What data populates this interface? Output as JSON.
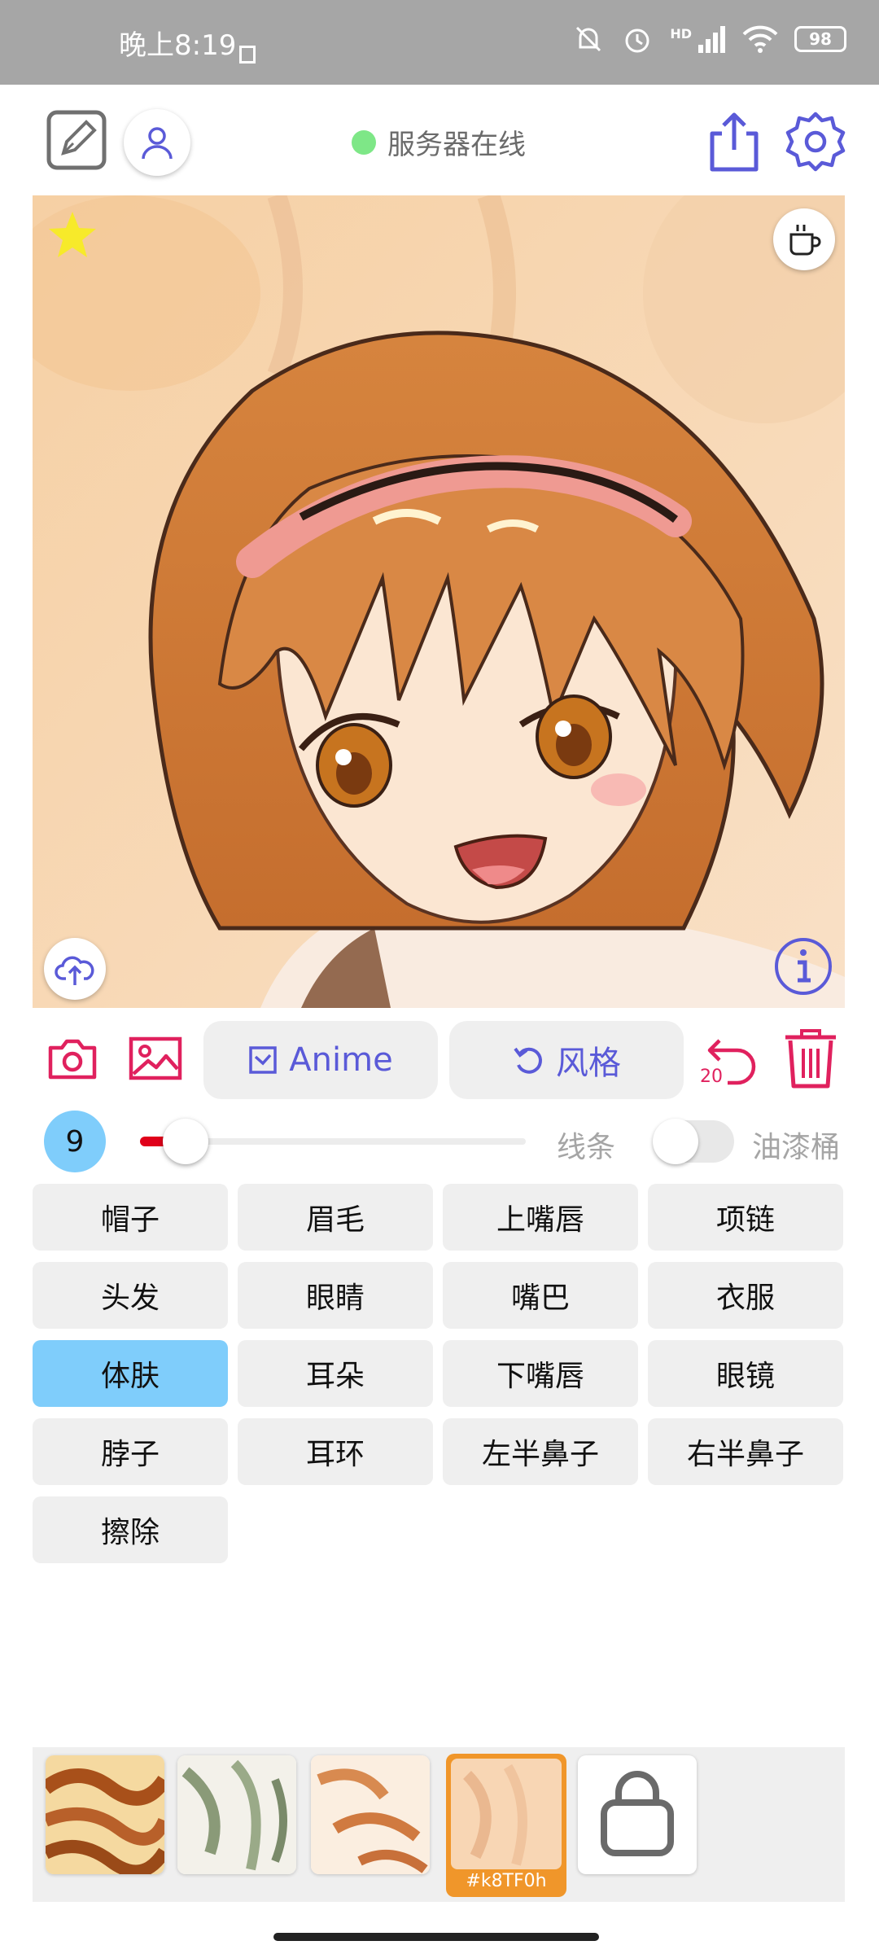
{
  "status_bar": {
    "time": "晚上8:19",
    "battery": "98",
    "network": "HD"
  },
  "toolbar": {
    "server_status": "服务器在线",
    "server_status_color": "#7ee787",
    "accent": "#5a5ad8",
    "icons": [
      "edit-icon",
      "user-icon",
      "share-icon",
      "settings-icon"
    ]
  },
  "canvas": {
    "icons": [
      "star-icon",
      "coffee-icon",
      "upload-cloud-icon",
      "info-icon"
    ]
  },
  "actions": {
    "anime_label": "Anime",
    "style_label": "风格",
    "undo_count": "20",
    "danger_color": "#e0215e"
  },
  "brush": {
    "size": "9",
    "size_fraction": 0.1,
    "line_label": "线条",
    "bucket_label": "油漆桶",
    "bucket_enabled": false
  },
  "labels": [
    {
      "text": "帽子"
    },
    {
      "text": "眉毛"
    },
    {
      "text": "上嘴唇"
    },
    {
      "text": "项链"
    },
    {
      "text": "头发"
    },
    {
      "text": "眼睛"
    },
    {
      "text": "嘴巴"
    },
    {
      "text": "衣服"
    },
    {
      "text": "体肤"
    },
    {
      "text": "耳朵"
    },
    {
      "text": "下嘴唇"
    },
    {
      "text": "眼镜"
    },
    {
      "text": "脖子"
    },
    {
      "text": "耳环"
    },
    {
      "text": "左半鼻子"
    },
    {
      "text": "右半鼻子"
    },
    {
      "text": "擦除"
    }
  ],
  "active_label": "体肤",
  "styles": {
    "active_code": "#k8TF0h",
    "icons": [
      "bag-icon"
    ]
  }
}
